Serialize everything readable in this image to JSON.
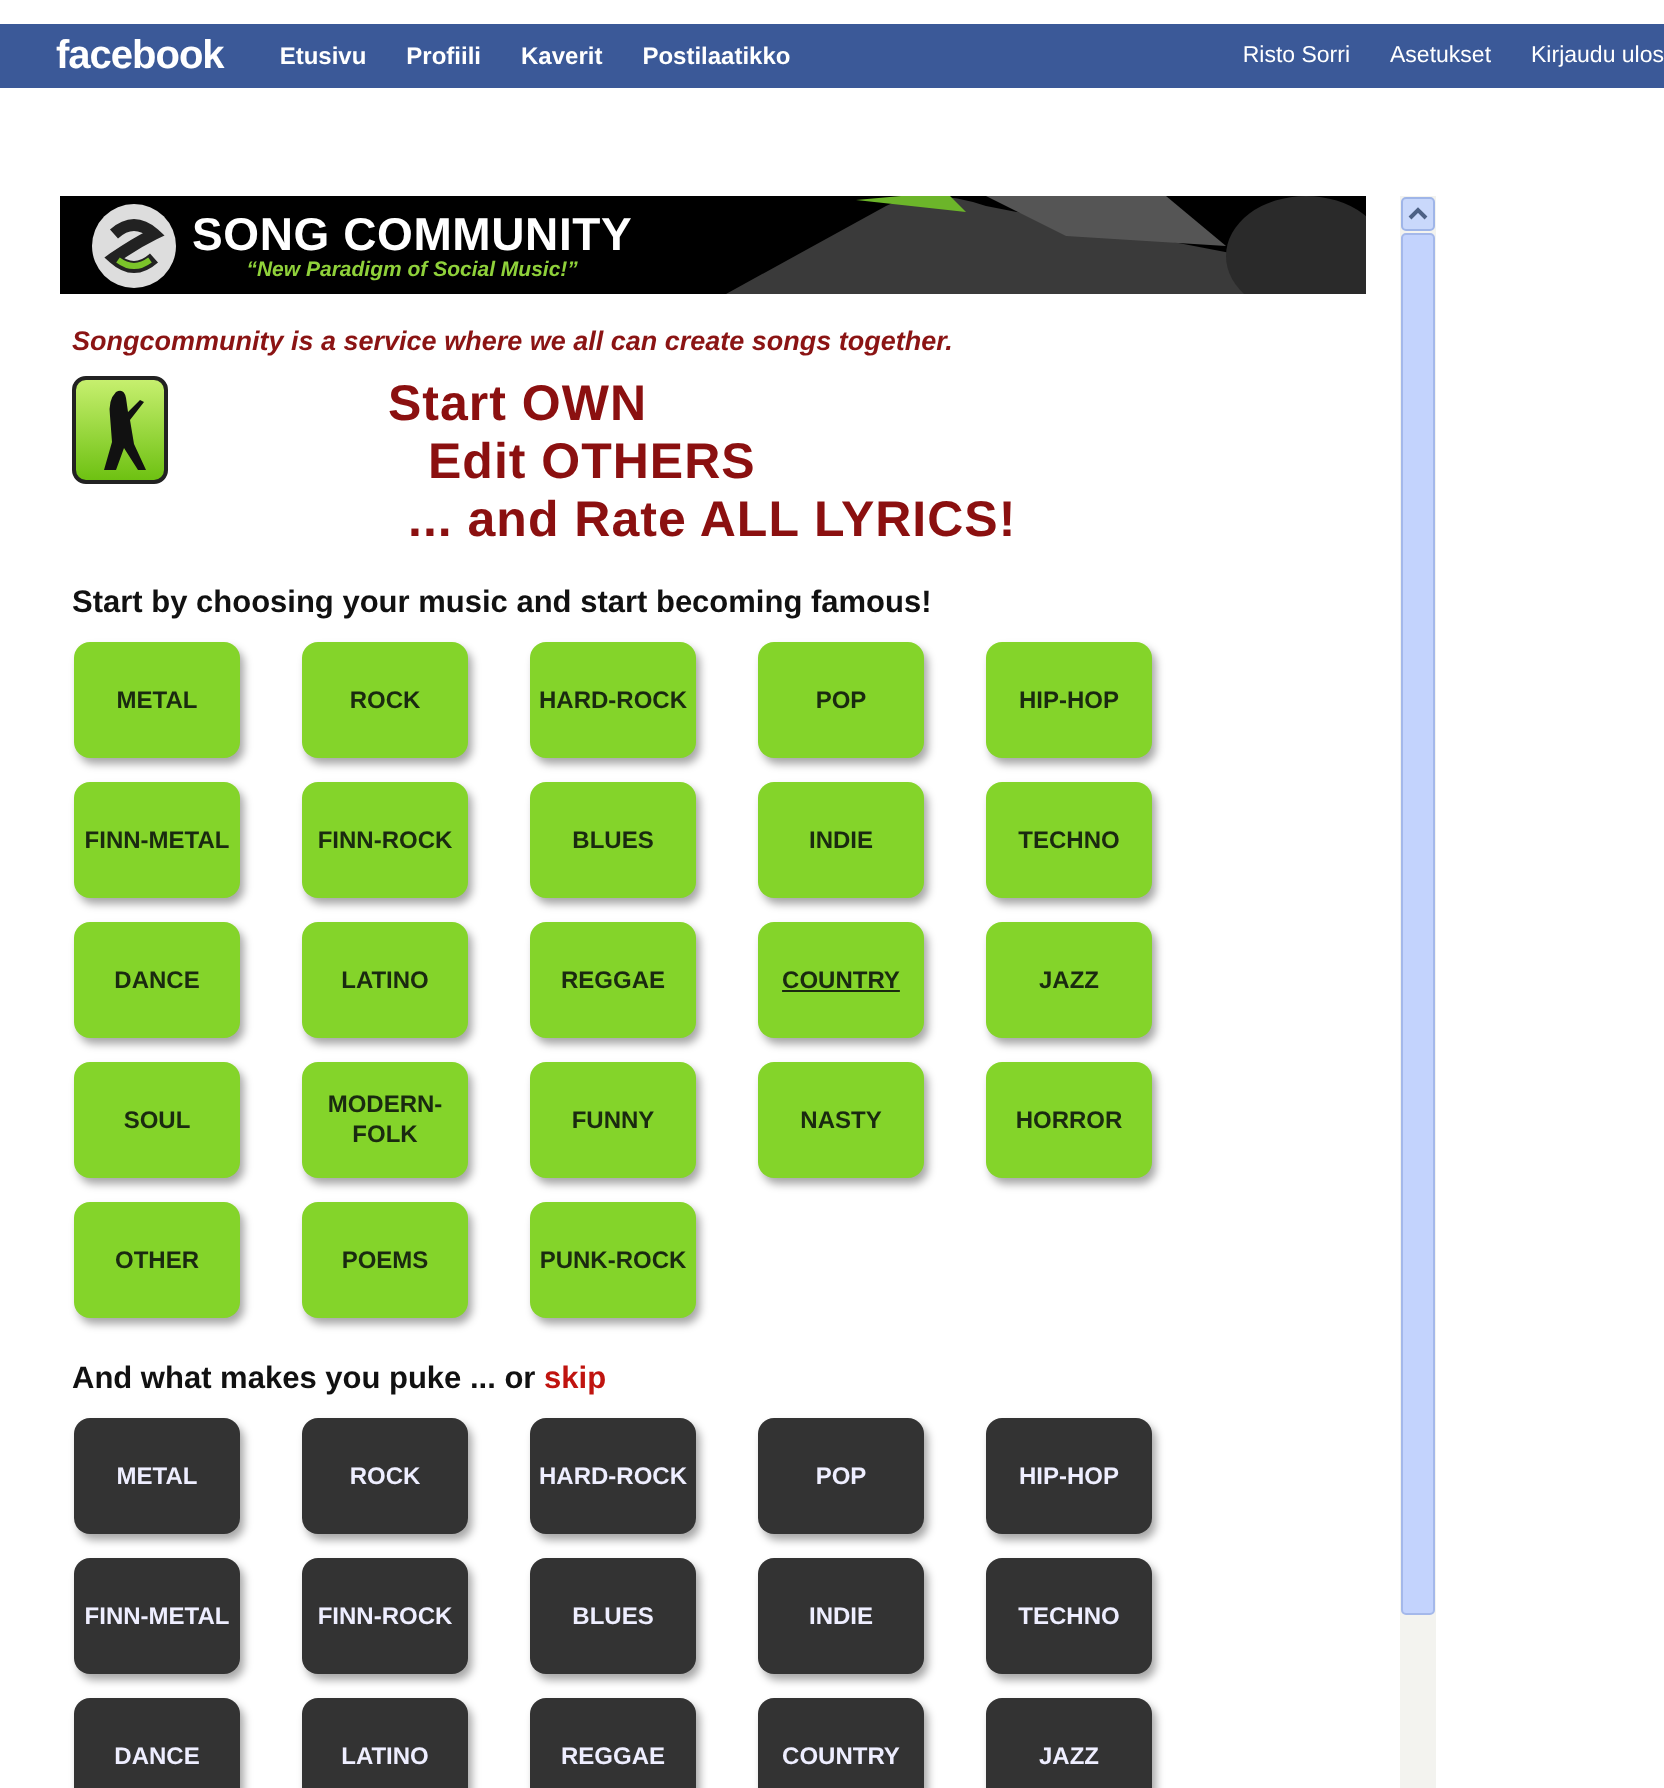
{
  "top_bar": {
    "logo": "facebook",
    "nav": [
      "Etusivu",
      "Profiili",
      "Kaverit",
      "Postilaatikko"
    ],
    "account": [
      "Risto Sorri",
      "Asetukset",
      "Kirjaudu ulos"
    ]
  },
  "banner": {
    "title": "SONG COMMUNITY",
    "tagline": "“New Paradigm of Social Music!”"
  },
  "intro": "Songcommunity is a service where we all can create songs together.",
  "slogan": [
    "Start OWN",
    "Edit OTHERS",
    "... and Rate ALL LYRICS!"
  ],
  "like_section": {
    "heading": "Start by choosing your music and start becoming famous!",
    "genres": [
      {
        "label": "METAL",
        "hovered": false
      },
      {
        "label": "ROCK",
        "hovered": false
      },
      {
        "label": "HARD-ROCK",
        "hovered": false
      },
      {
        "label": "POP",
        "hovered": false
      },
      {
        "label": "HIP-HOP",
        "hovered": false
      },
      {
        "label": "FINN-METAL",
        "hovered": false
      },
      {
        "label": "FINN-ROCK",
        "hovered": false
      },
      {
        "label": "BLUES",
        "hovered": false
      },
      {
        "label": "INDIE",
        "hovered": false
      },
      {
        "label": "TECHNO",
        "hovered": false
      },
      {
        "label": "DANCE",
        "hovered": false
      },
      {
        "label": "LATINO",
        "hovered": false
      },
      {
        "label": "REGGAE",
        "hovered": false
      },
      {
        "label": "COUNTRY",
        "hovered": true
      },
      {
        "label": "JAZZ",
        "hovered": false
      },
      {
        "label": "SOUL",
        "hovered": false
      },
      {
        "label": "MODERN-FOLK",
        "hovered": false
      },
      {
        "label": "FUNNY",
        "hovered": false
      },
      {
        "label": "NASTY",
        "hovered": false
      },
      {
        "label": "HORROR",
        "hovered": false
      },
      {
        "label": "OTHER",
        "hovered": false
      },
      {
        "label": "POEMS",
        "hovered": false
      },
      {
        "label": "PUNK-ROCK",
        "hovered": false
      }
    ]
  },
  "dislike_section": {
    "heading": "And what makes you puke ... or",
    "skip_link": "skip",
    "genres": [
      {
        "label": "METAL"
      },
      {
        "label": "ROCK"
      },
      {
        "label": "HARD-ROCK"
      },
      {
        "label": "POP"
      },
      {
        "label": "HIP-HOP"
      },
      {
        "label": "FINN-METAL"
      },
      {
        "label": "FINN-ROCK"
      },
      {
        "label": "BLUES"
      },
      {
        "label": "INDIE"
      },
      {
        "label": "TECHNO"
      },
      {
        "label": "DANCE"
      },
      {
        "label": "LATINO"
      },
      {
        "label": "REGGAE"
      },
      {
        "label": "COUNTRY"
      },
      {
        "label": "JAZZ"
      }
    ]
  }
}
